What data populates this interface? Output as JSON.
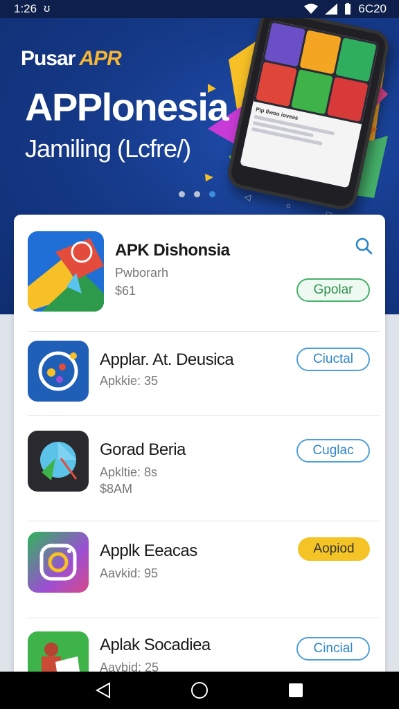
{
  "status": {
    "time": "1:26",
    "left_glyph": "ʊ",
    "right_text": "6C20"
  },
  "hero": {
    "brand_name": "Pusar",
    "brand_accent": "APR",
    "title": "APPlonesia",
    "subtitle": "Jamiling (Lcfre/)",
    "phone_card_title": "Pip Ilwoo ioveas"
  },
  "carousel": {
    "count": 3,
    "active_index": 2
  },
  "apps": [
    {
      "name": "APK Dishonsia",
      "meta1": "Pwborarh",
      "meta2": "$61",
      "button": "Gpolar",
      "button_style": "green"
    },
    {
      "name": "Applar. At. Deusica",
      "meta1": "Apkkie: 35",
      "meta2": "",
      "button": "Ciuctal",
      "button_style": "blue"
    },
    {
      "name": "Gorad Beria",
      "meta1": "Apkltie: 8s",
      "meta2": "$8AM",
      "button": "Cuglac",
      "button_style": "blue"
    },
    {
      "name": "Applk Eeacas",
      "meta1": "Aavkid: 95",
      "meta2": "",
      "button": "Aopiod",
      "button_style": "yellow"
    },
    {
      "name": "Aplak Socadiea",
      "meta1": "Aavbid: 25",
      "meta2": "",
      "button": "Cincial",
      "button_style": "blue"
    }
  ],
  "colors": {
    "hero_bg": "#163a8a",
    "accent_blue": "#2f86c9",
    "accent_green": "#45b06a",
    "accent_yellow": "#f4c426"
  }
}
